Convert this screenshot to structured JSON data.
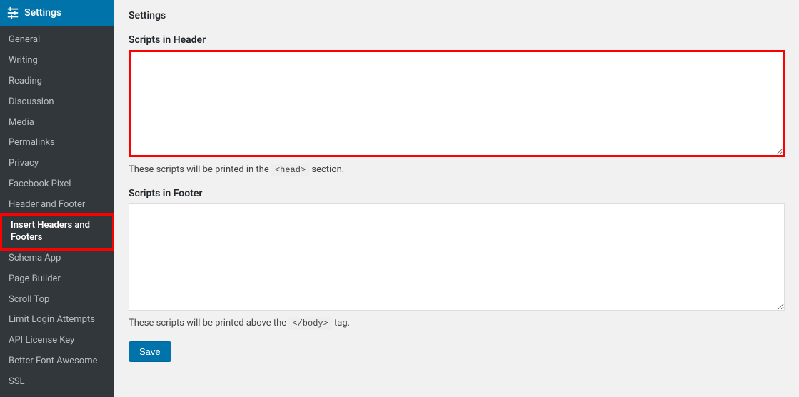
{
  "sidebar": {
    "header_label": "Settings",
    "items": [
      {
        "label": "General"
      },
      {
        "label": "Writing"
      },
      {
        "label": "Reading"
      },
      {
        "label": "Discussion"
      },
      {
        "label": "Media"
      },
      {
        "label": "Permalinks"
      },
      {
        "label": "Privacy"
      },
      {
        "label": "Facebook Pixel"
      },
      {
        "label": "Header and Footer"
      },
      {
        "label": "Insert Headers and Footers",
        "current": true,
        "highlighted": true
      },
      {
        "label": "Schema App"
      },
      {
        "label": "Page Builder"
      },
      {
        "label": "Scroll Top"
      },
      {
        "label": "Limit Login Attempts"
      },
      {
        "label": "API License Key"
      },
      {
        "label": "Better Font Awesome"
      },
      {
        "label": "SSL"
      }
    ]
  },
  "page": {
    "title": "Settings",
    "header_field": {
      "label": "Scripts in Header",
      "value": "",
      "desc_pre": "These scripts will be printed in the ",
      "desc_code": "<head>",
      "desc_post": " section.",
      "highlighted": true
    },
    "footer_field": {
      "label": "Scripts in Footer",
      "value": "",
      "desc_pre": "These scripts will be printed above the ",
      "desc_code": "</body>",
      "desc_post": " tag."
    },
    "save_label": "Save"
  }
}
